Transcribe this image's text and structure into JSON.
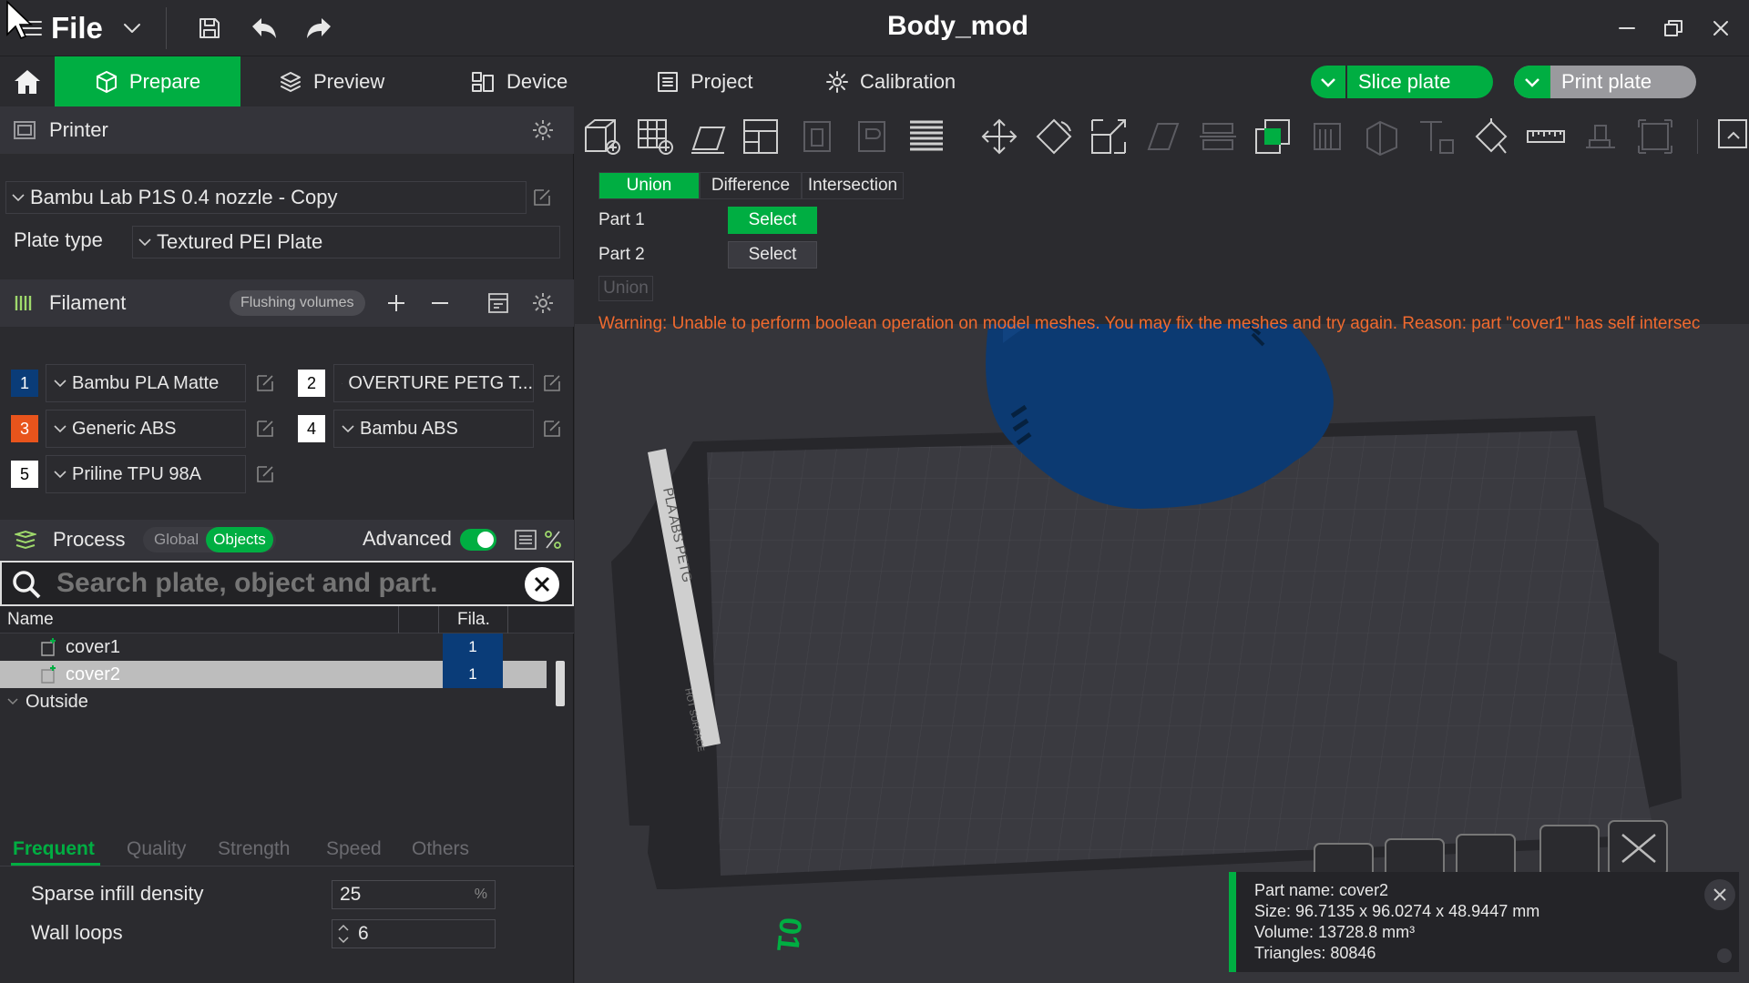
{
  "window": {
    "title": "Body_mod",
    "file_menu_label": "File"
  },
  "nav": {
    "tabs": [
      {
        "label": "Prepare",
        "icon": "cube-icon"
      },
      {
        "label": "Preview",
        "icon": "layers-icon"
      },
      {
        "label": "Device",
        "icon": "device-icon"
      },
      {
        "label": "Project",
        "icon": "project-icon"
      },
      {
        "label": "Calibration",
        "icon": "calibration-icon"
      }
    ],
    "active_tab": "Prepare",
    "slice_label": "Slice plate",
    "print_label": "Print plate"
  },
  "printer": {
    "section_title": "Printer",
    "preset": "Bambu Lab P1S 0.4 nozzle - Copy",
    "plate_type_label": "Plate type",
    "plate_type": "Textured PEI Plate"
  },
  "filament": {
    "section_title": "Filament",
    "flushing_label": "Flushing volumes",
    "items": [
      {
        "num": "1",
        "name": "Bambu PLA Matte",
        "color": "#0a3c78",
        "text_color": "#ffffff"
      },
      {
        "num": "2",
        "name": "OVERTURE PETG T...",
        "color": "#ffffff",
        "text_color": "#000000"
      },
      {
        "num": "3",
        "name": "Generic ABS",
        "color": "#e8541c",
        "text_color": "#ffffff"
      },
      {
        "num": "4",
        "name": "Bambu ABS",
        "color": "#ffffff",
        "text_color": "#000000"
      },
      {
        "num": "5",
        "name": "Priline TPU 98A",
        "color": "#ffffff",
        "text_color": "#000000"
      }
    ]
  },
  "process": {
    "section_title": "Process",
    "global_label": "Global",
    "objects_label": "Objects",
    "advanced_label": "Advanced",
    "advanced_on": true
  },
  "search": {
    "placeholder": "Search plate, object and part."
  },
  "tree": {
    "col_name": "Name",
    "col_fila": "Fila.",
    "rows": [
      {
        "name": "cover1",
        "fila": "1",
        "selected": false
      },
      {
        "name": "cover2",
        "fila": "1",
        "selected": true
      }
    ],
    "group_label": "Outside"
  },
  "param_tabs": [
    "Frequent",
    "Quality",
    "Strength",
    "Speed",
    "Others"
  ],
  "params": {
    "infill_label": "Sparse infill density",
    "infill_value": "25",
    "infill_unit": "%",
    "wall_label": "Wall loops",
    "wall_value": "6"
  },
  "boolean": {
    "tabs": [
      "Union",
      "Difference",
      "Intersection"
    ],
    "active": "Union",
    "part1_label": "Part 1",
    "part2_label": "Part 2",
    "select_label": "Select",
    "action_label": "Union",
    "warning": "Warning: Unable to perform boolean operation on model meshes. You may fix the meshes and try again. Reason: part \"cover1\" has self intersec"
  },
  "plate": {
    "label_vertical": "PLA ABS PETG",
    "hot_surface": "HOT SURFACE",
    "plate_number": "01"
  },
  "info": {
    "part_name": "Part name: cover2",
    "size": "Size: 96.7135 x 96.0274 x 48.9447 mm",
    "volume": "Volume: 13728.8 mm³",
    "triangles": "Triangles: 80846"
  },
  "colors": {
    "accent": "#00ae42",
    "warning": "#f06a2f",
    "model": "#0c3a72"
  }
}
